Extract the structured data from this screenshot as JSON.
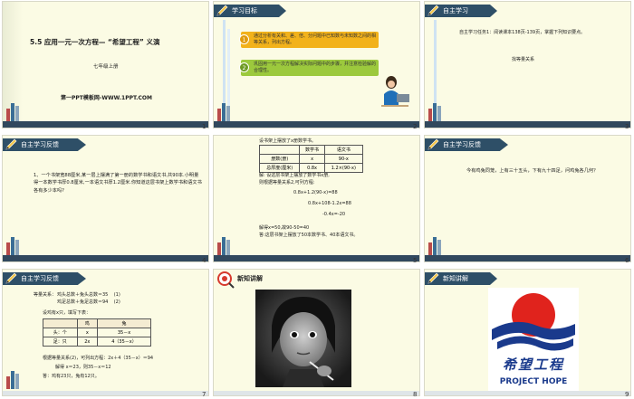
{
  "slides": [
    {
      "number": "1",
      "title": "5.5 应用一元一次方程— “希望工程” 义演",
      "subtitle": "七年级上册",
      "footer": "第一PPT模板网-WWW.1PPT.COM"
    },
    {
      "number": "2",
      "tab": "学习目标",
      "goals": [
        {
          "index": "1",
          "text": "通过分析有关和、差、倍、分问题中已知数与未知数之间的相等关系，列出方程。"
        },
        {
          "index": "2",
          "text": "巩固用一元一次方程解决实际问题中的步骤，并注意检验解的合理性。"
        }
      ]
    },
    {
      "number": "3",
      "tab": "自主学习",
      "task": "自主学习任务1：阅读课本138页-139页，掌握下列知识要点。",
      "item": "找等量关系"
    },
    {
      "number": "4",
      "tab": "自主学习反馈",
      "problem": "1、一个书架宽88厘米,某一层上摆满了第一册的数学书和语文书,共90本.小明量得一本数学书厚0.8厘米,一本语文书厚1.2厘米.你知道这层书架上数学书和语文书各有多少本吗?"
    },
    {
      "number": "5",
      "intro": "设书架上摆放了x册数学书。",
      "table": {
        "headers": [
          "",
          "数学书",
          "语文书"
        ],
        "rows": [
          [
            "册数(册)",
            "x",
            "90-x"
          ],
          [
            "总厚度(厘米)",
            "0.8x",
            "1.2×(90-x)"
          ]
        ]
      },
      "lines": [
        "解: 设这层书架上摆放了数学书x册,",
        "则根据等量关系2,可列方程:",
        "0.8x+1.2(90-x)=88",
        "0.8x+108-1.2x=88",
        "-0.4x=-20",
        "解得x=50,故90-50=40",
        "答:这层书架上摆放了50本数学书、40本语文书。"
      ]
    },
    {
      "number": "6",
      "tab": "自主学习反馈",
      "problem": "今有鸡兔同笼，上有三十五头，下有九十四足，问鸡兔各几何？"
    },
    {
      "number": "7",
      "tab": "自主学习反馈",
      "relation_label": "等量关系：",
      "relations": [
        "鸡头总数＋兔头总数＝35    (1)",
        "鸡足总数＋兔足总数＝94    (2)"
      ],
      "setup": "设鸡有x只，填写下表：",
      "table": {
        "headers": [
          "",
          "鸡",
          "兔"
        ],
        "rows": [
          [
            "头：个",
            "x",
            "35－x"
          ],
          [
            "足：只",
            "2x",
            "4（35－x）"
          ]
        ]
      },
      "equation": "根据等量关系(2)，可列出方程：2x＋4（35－x）＝94",
      "solution": "解得 x＝23，则35－x＝12",
      "answer": "答：鸡有23只，兔有12只。"
    },
    {
      "number": "8",
      "tab": "新知讲解"
    },
    {
      "number": "9",
      "tab": "新知讲解",
      "logo_caption": "PROJECT HOPE",
      "logo_script": "希望工程"
    }
  ],
  "colors": {
    "slide_bg": "#fbfbe4",
    "navy": "#2e4f67",
    "band": "#31485e",
    "goal1": "#f2b21b",
    "goal2": "#9cc93d",
    "logo_red": "#e0231d",
    "logo_blue": "#1a3a8c"
  }
}
